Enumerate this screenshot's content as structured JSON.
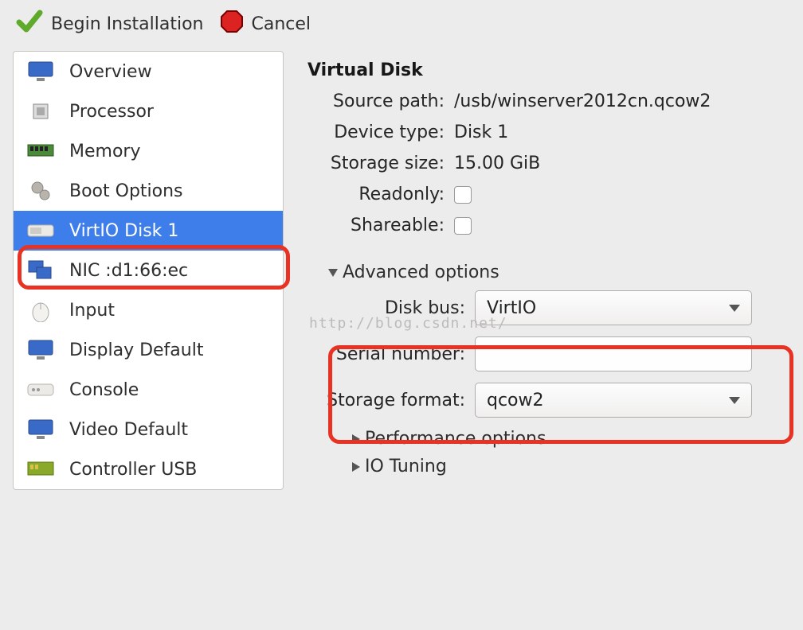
{
  "toolbar": {
    "begin_label": "Begin Installation",
    "cancel_label": "Cancel"
  },
  "sidebar": {
    "items": [
      {
        "label": "Overview",
        "icon": "monitor-icon"
      },
      {
        "label": "Processor",
        "icon": "cpu-icon"
      },
      {
        "label": "Memory",
        "icon": "ram-icon"
      },
      {
        "label": "Boot Options",
        "icon": "gears-icon"
      },
      {
        "label": "VirtIO Disk 1",
        "icon": "disk-icon",
        "selected": true
      },
      {
        "label": "NIC :d1:66:ec",
        "icon": "nic-icon"
      },
      {
        "label": "Input",
        "icon": "mouse-icon"
      },
      {
        "label": "Display Default",
        "icon": "monitor-icon"
      },
      {
        "label": "Console",
        "icon": "console-icon"
      },
      {
        "label": "Video Default",
        "icon": "monitor-icon"
      },
      {
        "label": "Controller USB",
        "icon": "pci-icon"
      }
    ]
  },
  "detail": {
    "title": "Virtual Disk",
    "source_path_label": "Source path:",
    "source_path_value": "/usb/winserver2012cn.qcow2",
    "device_type_label": "Device type:",
    "device_type_value": "Disk 1",
    "storage_size_label": "Storage size:",
    "storage_size_value": "15.00 GiB",
    "readonly_label": "Readonly:",
    "readonly_checked": false,
    "shareable_label": "Shareable:",
    "shareable_checked": false,
    "advanced_label": "Advanced options",
    "disk_bus_label": "Disk bus:",
    "disk_bus_value": "VirtIO",
    "serial_label": "Serial number:",
    "serial_value": "",
    "storage_format_label": "Storage format:",
    "storage_format_value": "qcow2",
    "perf_label": "Performance options",
    "io_label": "IO Tuning"
  },
  "watermark": "http://blog.csdn.net/"
}
